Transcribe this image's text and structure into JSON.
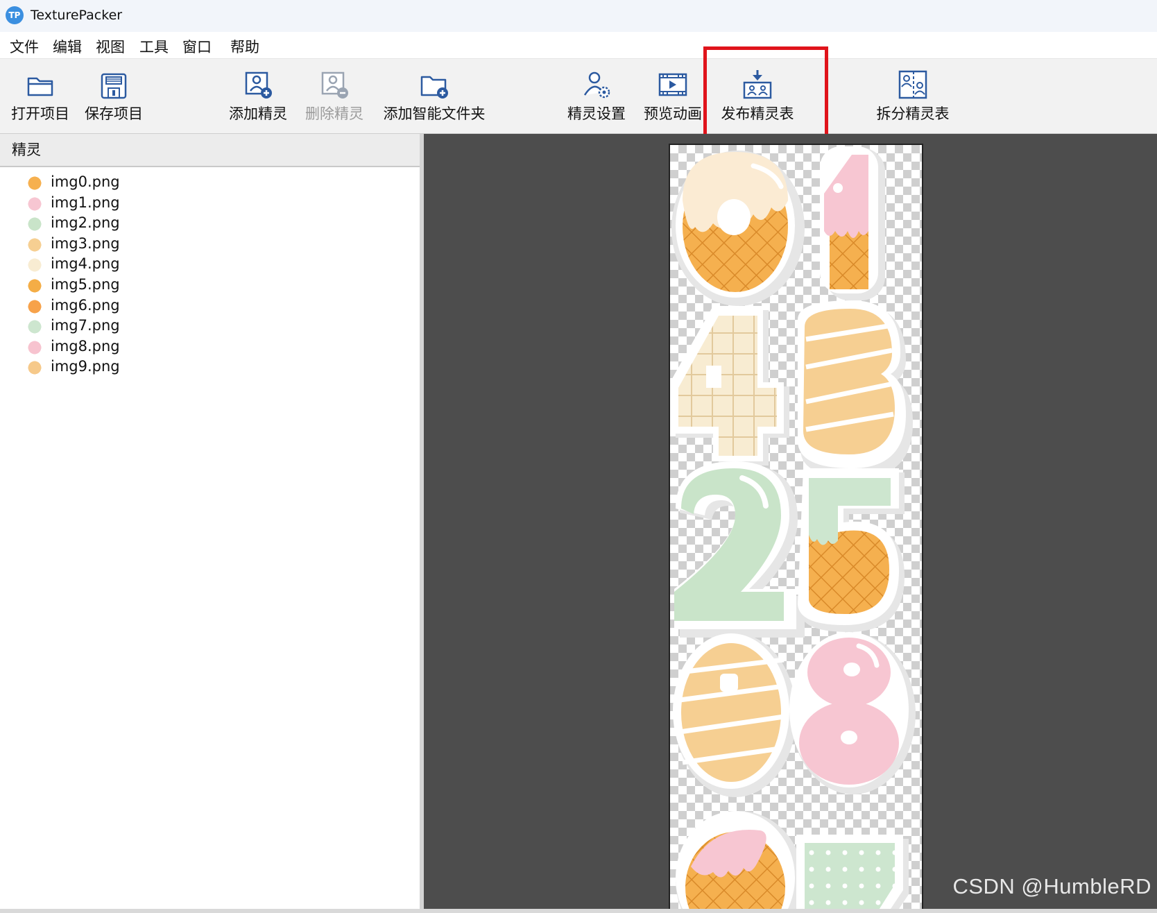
{
  "window": {
    "title": "TexturePacker",
    "logo_text": "TP"
  },
  "menu": [
    "文件",
    "编辑",
    "视图",
    "工具",
    "窗口",
    "帮助"
  ],
  "toolbar": {
    "open_project": "打开项目",
    "save_project": "保存项目",
    "add_sprite": "添加精灵",
    "delete_sprite": "删除精灵",
    "add_smart_folder": "添加智能文件夹",
    "sprite_settings": "精灵设置",
    "preview_animation": "预览动画",
    "publish_sprite_sheet": "发布精灵表",
    "split_sprite_sheet": "拆分精灵表"
  },
  "toolbar_state": {
    "delete_sprite_enabled": false,
    "highlighted": "publish_sprite_sheet",
    "highlight_color": "#e0141b"
  },
  "sprites_panel": {
    "header": "精灵",
    "items": [
      {
        "name": "img0.png",
        "color": "#f6b04f"
      },
      {
        "name": "img1.png",
        "color": "#f7c6d2"
      },
      {
        "name": "img2.png",
        "color": "#c9e4c9"
      },
      {
        "name": "img3.png",
        "color": "#f6cf92"
      },
      {
        "name": "img4.png",
        "color": "#f8ecd2"
      },
      {
        "name": "img5.png",
        "color": "#f4ad46"
      },
      {
        "name": "img6.png",
        "color": "#f7a24a"
      },
      {
        "name": "img7.png",
        "color": "#cde6cf"
      },
      {
        "name": "img8.png",
        "color": "#f7c3cf"
      },
      {
        "name": "img9.png",
        "color": "#f6c98a"
      }
    ]
  },
  "watermark": "CSDN @HumbleRD",
  "colors": {
    "canvas_bg": "#4d4d4d",
    "icon_blue": "#2c5aa0"
  }
}
